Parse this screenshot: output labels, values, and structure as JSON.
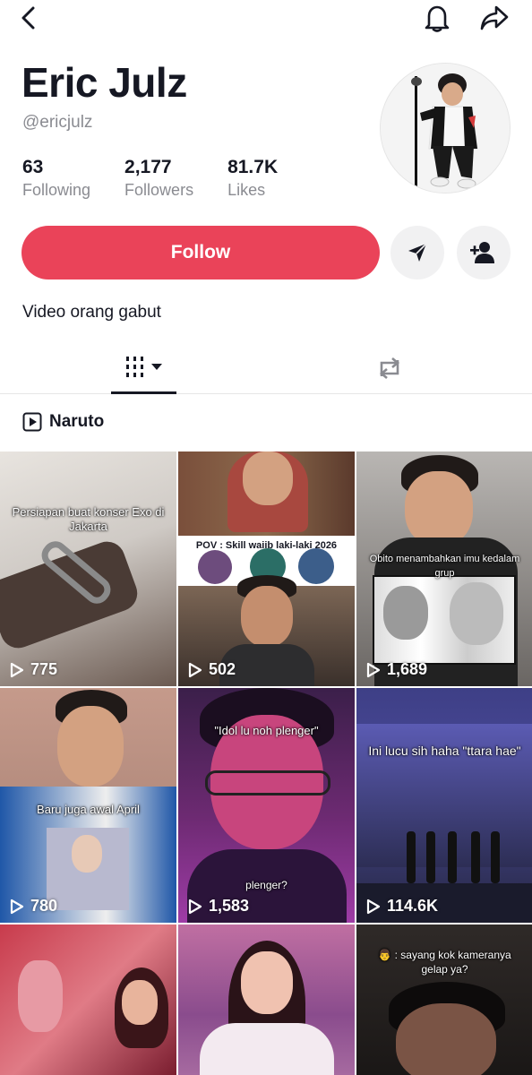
{
  "header": {
    "back_icon": "chevron-left-icon",
    "bell_icon": "bell-icon",
    "share_icon": "share-arrow-icon"
  },
  "profile": {
    "name": "Eric Julz",
    "handle": "@ericjulz",
    "stats": [
      {
        "value": "63",
        "label": "Following"
      },
      {
        "value": "2,177",
        "label": "Followers"
      },
      {
        "value": "81.7K",
        "label": "Likes"
      }
    ],
    "bio": "Video orang gabut"
  },
  "actions": {
    "follow_label": "Follow",
    "message_icon": "send-icon",
    "add_user_icon": "add-user-icon"
  },
  "colors": {
    "follow": "#ea4359"
  },
  "tabs": {
    "videos_icon": "grid-icon",
    "reposts_icon": "repost-icon"
  },
  "playlist": {
    "label": "Naruto"
  },
  "videos": [
    {
      "views": "775",
      "caption": "Persiapan buat konser Exo di Jakarta"
    },
    {
      "views": "502",
      "caption": "POV : Skill waiib laki-laki 2026"
    },
    {
      "views": "1,689",
      "caption": "Obito menambahkan imu kedalam grup"
    },
    {
      "views": "780",
      "caption": "Baru juga awal April"
    },
    {
      "views": "1,583",
      "caption": "\"Idol lu noh plenger\"",
      "caption2": "plenger?"
    },
    {
      "views": "114.6K",
      "caption": "Ini lucu sih haha \"ttara hae\""
    },
    {
      "views": "",
      "caption": ""
    },
    {
      "views": "",
      "caption": ""
    },
    {
      "views": "",
      "caption": "👨 : sayang kok kameranya gelap ya?"
    }
  ]
}
